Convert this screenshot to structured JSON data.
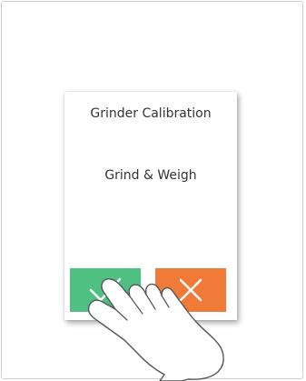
{
  "dialog": {
    "title": "Grinder Calibration",
    "message": "Grind & Weigh"
  },
  "buttons": {
    "confirm_icon": "check-icon",
    "cancel_icon": "close-icon"
  },
  "colors": {
    "confirm": "#4fbf82",
    "cancel": "#f07a38"
  }
}
